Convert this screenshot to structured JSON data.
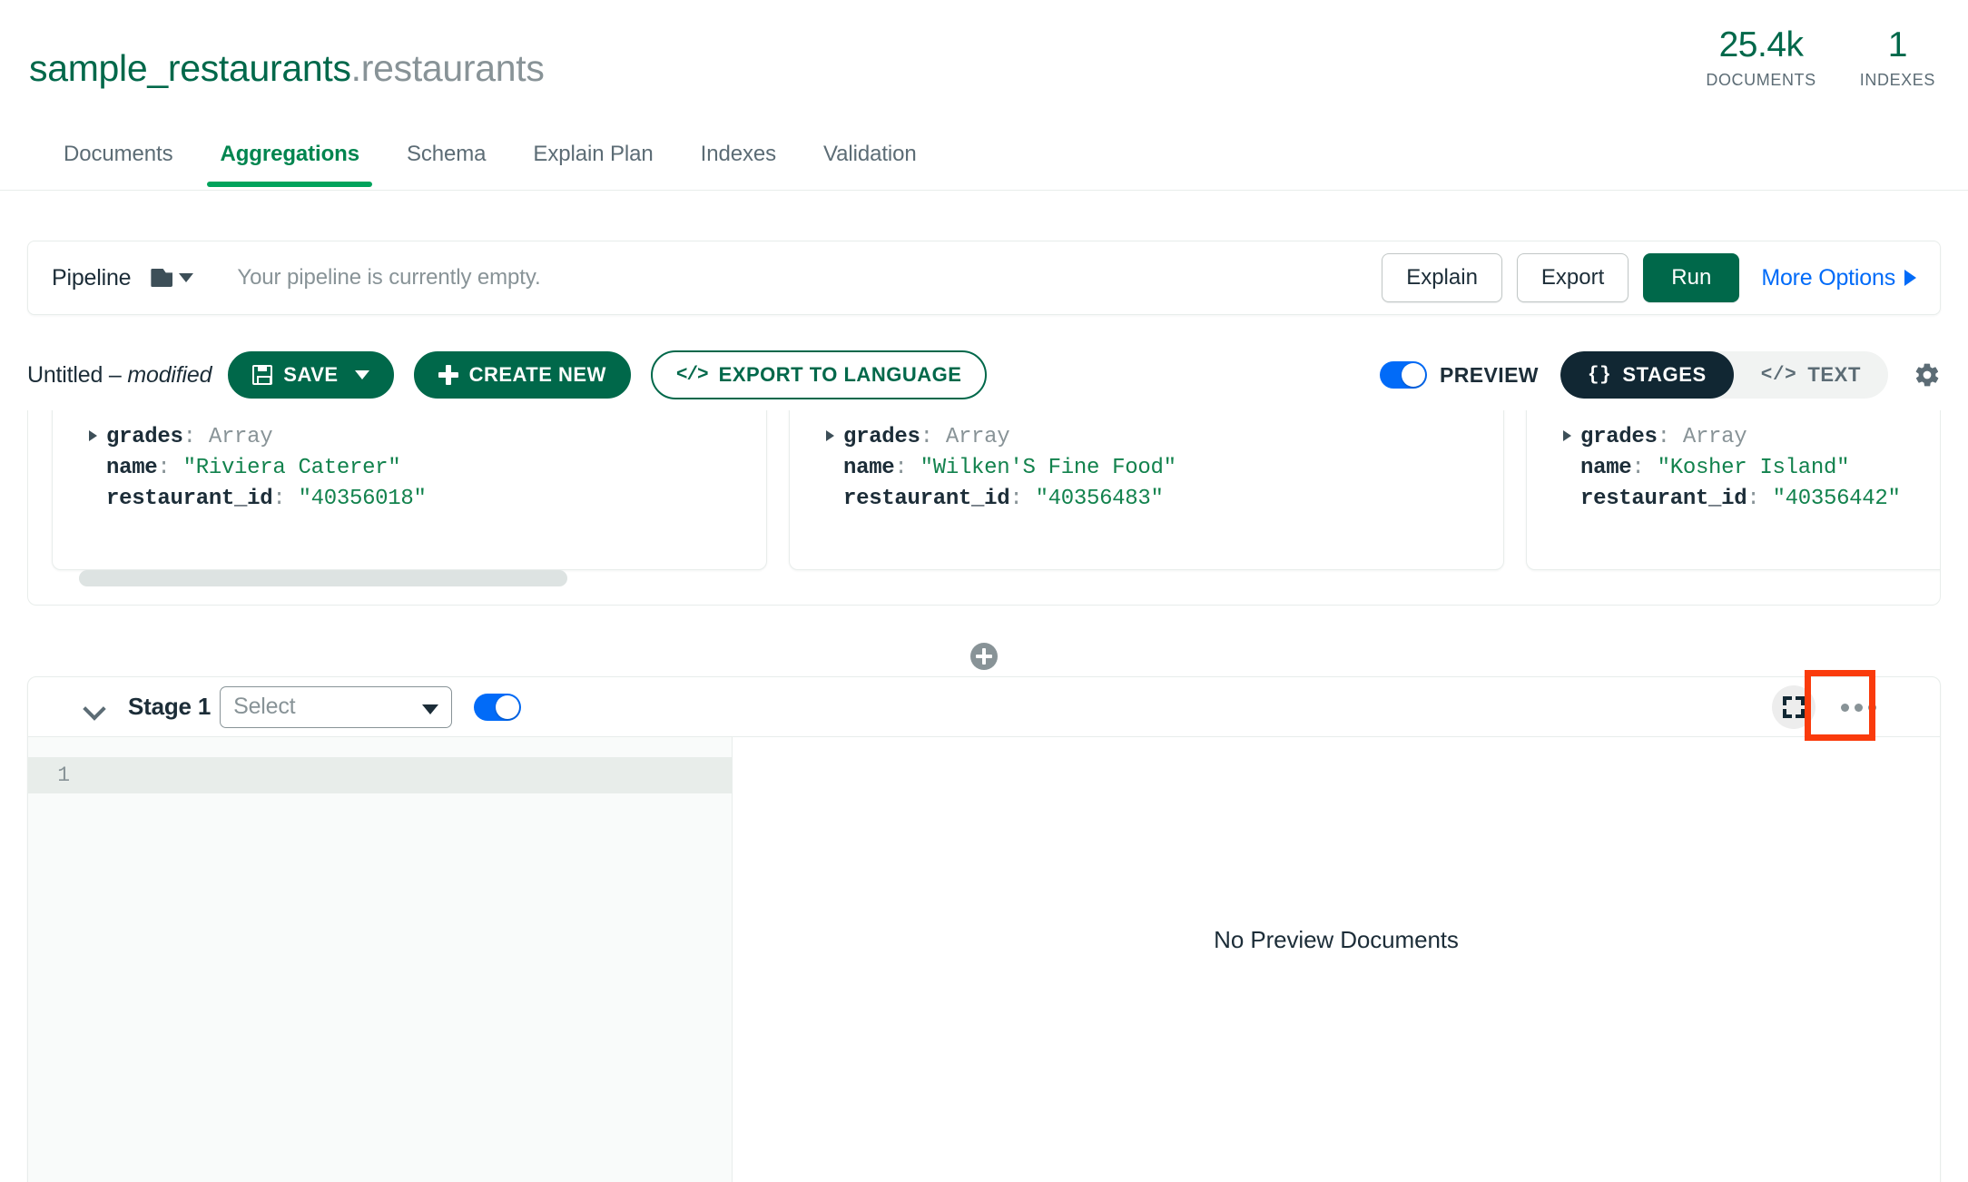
{
  "header": {
    "namespace_db": "sample_restaurants",
    "namespace_sep": ".",
    "namespace_collection": "restaurants",
    "stats": [
      {
        "value": "25.4k",
        "label": "DOCUMENTS"
      },
      {
        "value": "1",
        "label": "INDEXES"
      }
    ]
  },
  "tabs": [
    {
      "label": "Documents",
      "active": false
    },
    {
      "label": "Aggregations",
      "active": true
    },
    {
      "label": "Schema",
      "active": false
    },
    {
      "label": "Explain Plan",
      "active": false
    },
    {
      "label": "Indexes",
      "active": false
    },
    {
      "label": "Validation",
      "active": false
    }
  ],
  "pipeline_bar": {
    "label": "Pipeline",
    "folder_icon": "folder-icon",
    "caret_icon": "chevron-down-icon",
    "empty_message": "Your pipeline is currently empty.",
    "explain_label": "Explain",
    "export_label": "Export",
    "run_label": "Run",
    "more_options_label": "More Options",
    "more_options_icon": "caret-right-icon"
  },
  "toolbar": {
    "pipeline_name": "Untitled",
    "pipeline_dash": "–",
    "pipeline_state": "modified",
    "save_label": "SAVE",
    "save_icon": "floppy-disk-icon",
    "save_caret_icon": "chevron-down-icon",
    "create_new_label": "CREATE NEW",
    "create_new_icon": "plus-icon",
    "export_to_language_label": "EXPORT TO LANGUAGE",
    "export_to_language_icon": "code-brackets-icon",
    "preview_label": "PREVIEW",
    "preview_toggle_on": true,
    "stages_label": "STAGES",
    "stages_icon": "curly-braces-icon",
    "text_label": "TEXT",
    "text_icon": "code-brackets-icon",
    "settings_icon": "gear-icon"
  },
  "preview_documents": [
    {
      "grades_key": "grades",
      "grades_type": "Array",
      "name_key": "name",
      "name_value": "\"Riviera Caterer\"",
      "restaurant_id_key": "restaurant_id",
      "restaurant_id_value": "\"40356018\""
    },
    {
      "grades_key": "grades",
      "grades_type": "Array",
      "name_key": "name",
      "name_value": "\"Wilken'S Fine Food\"",
      "restaurant_id_key": "restaurant_id",
      "restaurant_id_value": "\"40356483\""
    },
    {
      "grades_key": "grades",
      "grades_type": "Array",
      "name_key": "name",
      "name_value": "\"Kosher Island\"",
      "restaurant_id_key": "restaurant_id",
      "restaurant_id_value": "\"40356442\""
    }
  ],
  "add_stage": {
    "icon": "plus-circle-icon"
  },
  "stage": {
    "collapse_icon": "chevron-down-icon",
    "number_label": "Stage 1",
    "operator_placeholder": "Select",
    "operator_value": "",
    "enabled_toggle_on": true,
    "expand_icon": "expand-icon",
    "menu_icon": "ellipsis-icon",
    "editor_line_number": "1",
    "editor_content": "",
    "no_preview_message": "No Preview Documents"
  },
  "colors": {
    "brand_green": "#00684A",
    "accent_green": "#00A35C",
    "link_blue": "#016BF8",
    "toggle_blue": "#016BF8",
    "dark_pill": "#112733",
    "highlight_red": "#FA3B0C",
    "muted_text": "#889397"
  }
}
